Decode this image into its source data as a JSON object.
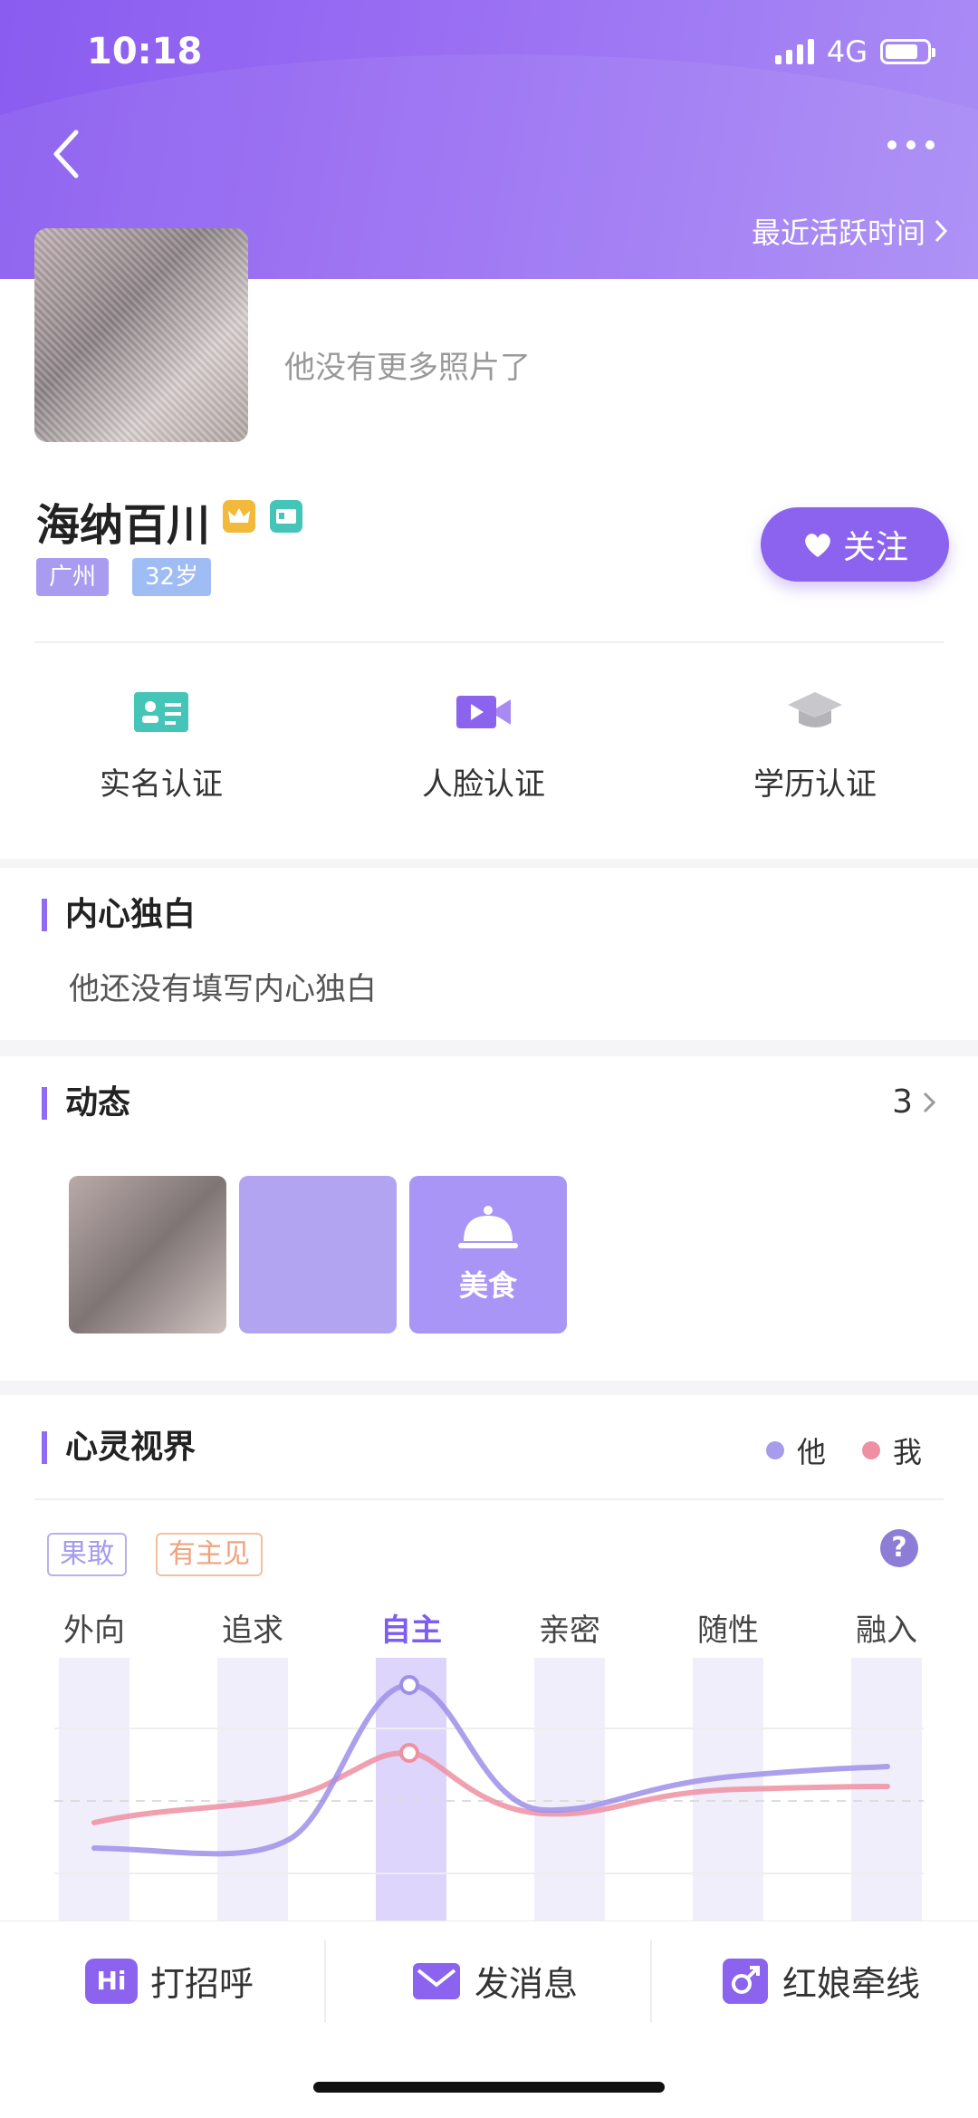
{
  "status_bar": {
    "time": "10:18",
    "network": "4G",
    "signal_bars": 4,
    "battery_level": 0.8
  },
  "header": {
    "recent_active": "最近活跃时间"
  },
  "profile": {
    "no_more_photos": "他没有更多照片了",
    "name": "海纳百川",
    "city": "广州",
    "age": "32岁",
    "follow_label": "关注",
    "badges": [
      "crown-icon",
      "id-card-icon"
    ]
  },
  "verifications": [
    {
      "label": "实名认证",
      "icon": "id-card-icon",
      "color": "#45c5b8"
    },
    {
      "label": "人脸认证",
      "icon": "video-icon",
      "color": "#8b63ee"
    },
    {
      "label": "学历认证",
      "icon": "graduation-cap-icon",
      "color": "#c8c8cc"
    }
  ],
  "monologue": {
    "title": "内心独白",
    "text": "他还没有填写内心独白"
  },
  "moments": {
    "title": "动态",
    "count": "3",
    "tile_label": "美食"
  },
  "mind": {
    "title": "心灵视界",
    "legend_him": "他",
    "legend_me": "我",
    "traits": [
      "果敢",
      "有主见"
    ],
    "help": "?",
    "dimensions": [
      "外向",
      "追求",
      "自主",
      "亲密",
      "随性",
      "融入"
    ],
    "selected_dimension": "自主"
  },
  "bottom_bar": {
    "greet": "打招呼",
    "greet_badge": "Hi",
    "message": "发消息",
    "matchmaker": "红娘牵线"
  },
  "colors": {
    "accent": "#8b63ee",
    "him": "#a79cec",
    "me": "#ee8fa2"
  }
}
